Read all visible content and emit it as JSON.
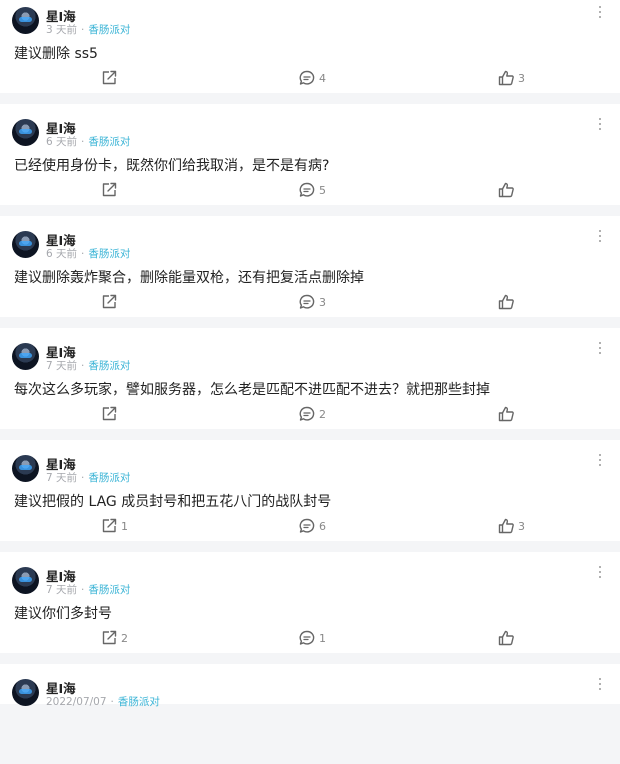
{
  "posts": [
    {
      "user": "星I海",
      "time": "3 天前",
      "circle": "香肠派对",
      "content": "建议删除 ss5",
      "shares": "",
      "comments": "4",
      "likes": "3"
    },
    {
      "user": "星I海",
      "time": "6 天前",
      "circle": "香肠派对",
      "content": "已经使用身份卡，既然你们给我取消，是不是有病?",
      "shares": "",
      "comments": "5",
      "likes": ""
    },
    {
      "user": "星I海",
      "time": "6 天前",
      "circle": "香肠派对",
      "content": "建议删除轰炸聚合，删除能量双枪，还有把复活点删除掉",
      "shares": "",
      "comments": "3",
      "likes": ""
    },
    {
      "user": "星I海",
      "time": "7 天前",
      "circle": "香肠派对",
      "content": "每次这么多玩家，譬如服务器，怎么老是匹配不进匹配不进去？就把那些封掉",
      "shares": "",
      "comments": "2",
      "likes": ""
    },
    {
      "user": "星I海",
      "time": "7 天前",
      "circle": "香肠派对",
      "content": "建议把假的 LAG 成员封号和把五花八门的战队封号",
      "shares": "1",
      "comments": "6",
      "likes": "3"
    },
    {
      "user": "星I海",
      "time": "7 天前",
      "circle": "香肠派对",
      "content": "建议你们多封号",
      "shares": "2",
      "comments": "1",
      "likes": ""
    },
    {
      "user": "星I海",
      "time": "2022/07/07",
      "circle": "香肠派对",
      "content": "",
      "shares": "",
      "comments": "",
      "likes": ""
    }
  ]
}
